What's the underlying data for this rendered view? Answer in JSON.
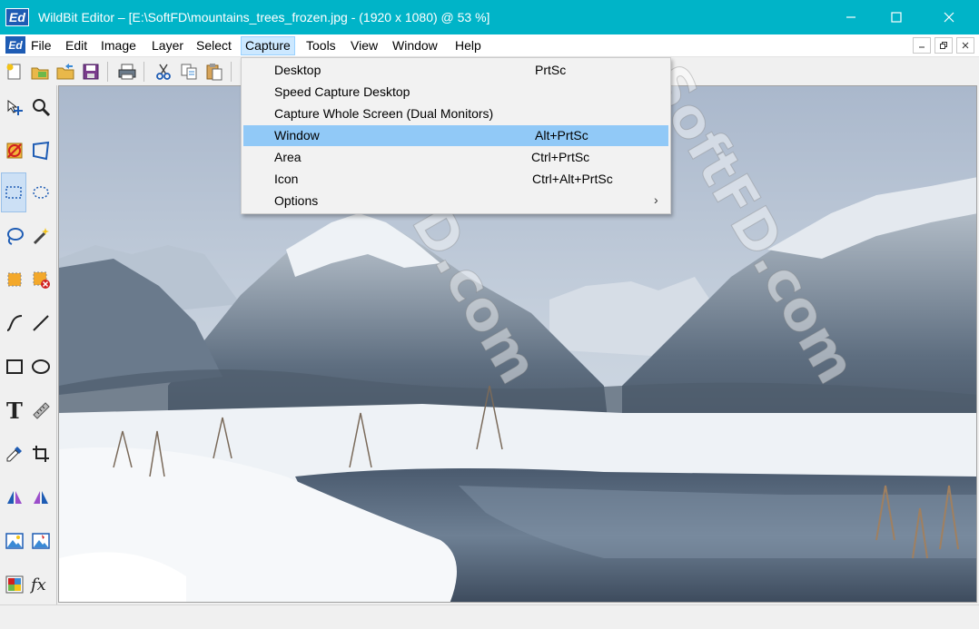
{
  "titlebar": {
    "app_icon": "Ed",
    "title": "WildBit Editor – [E:\\SoftFD\\mountains_trees_frozen.jpg - (1920 x 1080) @ 53  %]",
    "buttons": [
      "minimize-icon",
      "maximize-icon",
      "close-icon"
    ]
  },
  "menubar": {
    "doc_icon": "Ed",
    "items": [
      {
        "label": "File"
      },
      {
        "label": "Edit"
      },
      {
        "label": "Image"
      },
      {
        "label": "Layer"
      },
      {
        "label": "Select"
      },
      {
        "label": "Capture"
      },
      {
        "label": "Tools"
      },
      {
        "label": "View"
      },
      {
        "label": "Window"
      },
      {
        "label": "Help"
      }
    ],
    "active": "Capture"
  },
  "toolbar": {
    "buttons": [
      "new-icon",
      "open-browser-icon",
      "open-folder-icon",
      "save-icon",
      "print-icon",
      "cut-icon",
      "copy-icon",
      "paste-icon"
    ]
  },
  "tools": [
    "move-icon",
    "zoom-icon",
    "no-crop-icon",
    "perspective-icon",
    "rect-select-icon",
    "ellipse-select-icon",
    "lasso-icon",
    "magic-wand-icon",
    "fill-square-icon",
    "remove-square-icon",
    "curve-icon",
    "line-icon",
    "rectangle-icon",
    "ellipse-icon",
    "text-icon",
    "ruler-icon",
    "eyedropper-icon",
    "crop-icon",
    "flip-horizontal-icon",
    "flip-vertical-icon",
    "image-adjust-icon",
    "image-effect-icon",
    "color-palette-icon",
    "fx-icon"
  ],
  "capture_menu": {
    "items": [
      {
        "label": "Desktop",
        "shortcut": "PrtSc"
      },
      {
        "label": "Speed Capture Desktop",
        "shortcut": ""
      },
      {
        "label": "Capture Whole Screen (Dual Monitors)",
        "shortcut": ""
      },
      {
        "label": "Window",
        "shortcut": "Alt+PrtSc"
      },
      {
        "label": "Area",
        "shortcut": "Ctrl+PrtSc"
      },
      {
        "label": "Icon",
        "shortcut": "Ctrl+Alt+PrtSc"
      },
      {
        "label": "Options",
        "shortcut": "",
        "submenu_arrow": "›"
      }
    ],
    "highlighted": "Window"
  },
  "watermark": "SoftFD.com",
  "colors": {
    "titlebar": "#00b4c8",
    "highlight": "#91c9f7",
    "menu_active": "#cce8ff"
  }
}
